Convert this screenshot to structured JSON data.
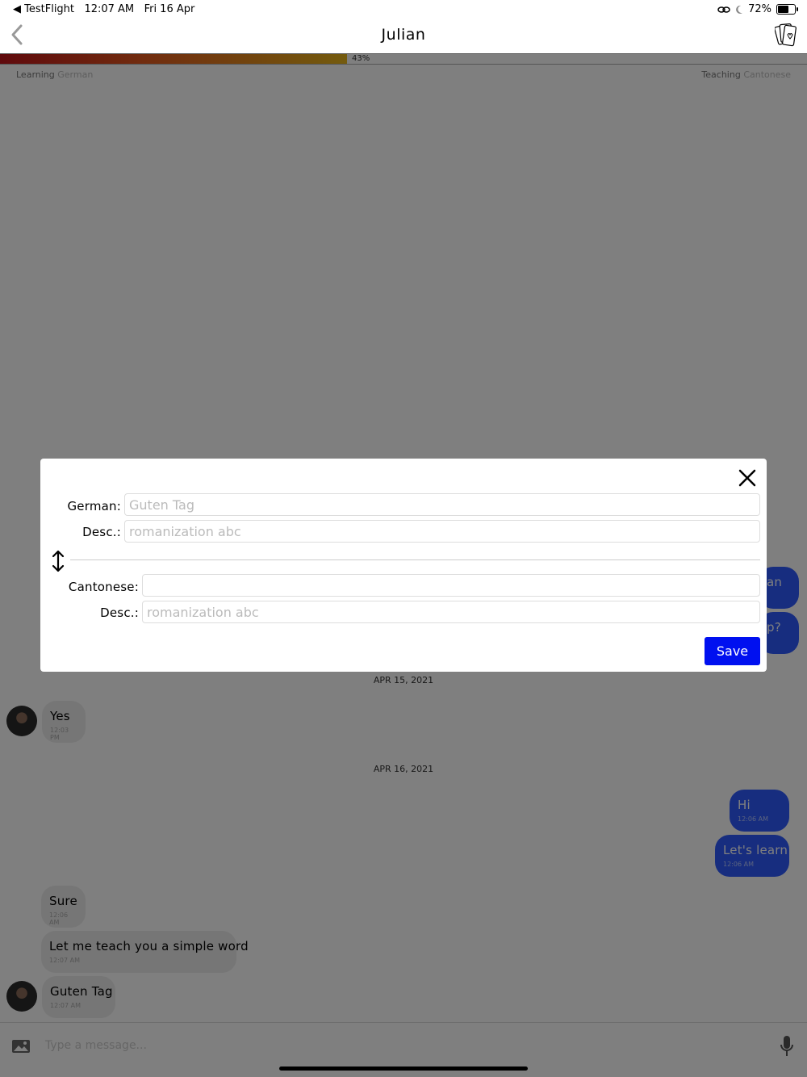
{
  "status_bar": {
    "back_app": "◀ TestFlight",
    "time": "12:07 AM",
    "date": "Fri 16 Apr",
    "battery": "72%",
    "battery_level": 0.72
  },
  "header": {
    "title": "Julian",
    "back_icon": "chevron-left-icon",
    "cards_icon": "flashcards-icon"
  },
  "progress": {
    "value_label": "43%",
    "value": 0.43,
    "learning_label": "Learning",
    "learning_language": "German",
    "teaching_label": "Teaching",
    "teaching_language": "Cantonese"
  },
  "chat": {
    "hidden_partial_1": "an",
    "hidden_partial_2": "p?",
    "date_1": "APR 15, 2021",
    "msg_yes": {
      "text": "Yes",
      "time": "12:03 PM"
    },
    "date_2": "APR 16, 2021",
    "msg_hi": {
      "text": "Hi",
      "time": "12:06 AM"
    },
    "msg_lets_learn": {
      "text": "Let's learn",
      "time": "12:06 AM"
    },
    "msg_sure": {
      "text": "Sure",
      "time": "12:06 AM"
    },
    "msg_teach": {
      "text": "Let me teach you a simple word",
      "time": "12:07 AM"
    },
    "msg_guten": {
      "text": "Guten Tag",
      "time": "12:07 AM"
    }
  },
  "composer": {
    "placeholder": "Type a message..."
  },
  "modal": {
    "source_label": "German:",
    "source_value": "",
    "source_placeholder": "Guten Tag",
    "source_desc_label": "Desc.:",
    "source_desc_placeholder": "romanization abc",
    "target_label": "Cantonese:",
    "target_value": "",
    "target_desc_label": "Desc.:",
    "target_desc_placeholder": "romanization abc",
    "save_label": "Save"
  },
  "colors": {
    "accent": "#0010f0",
    "outgoing_bubble": "#2e5bff",
    "incoming_bubble": "#ececec"
  }
}
